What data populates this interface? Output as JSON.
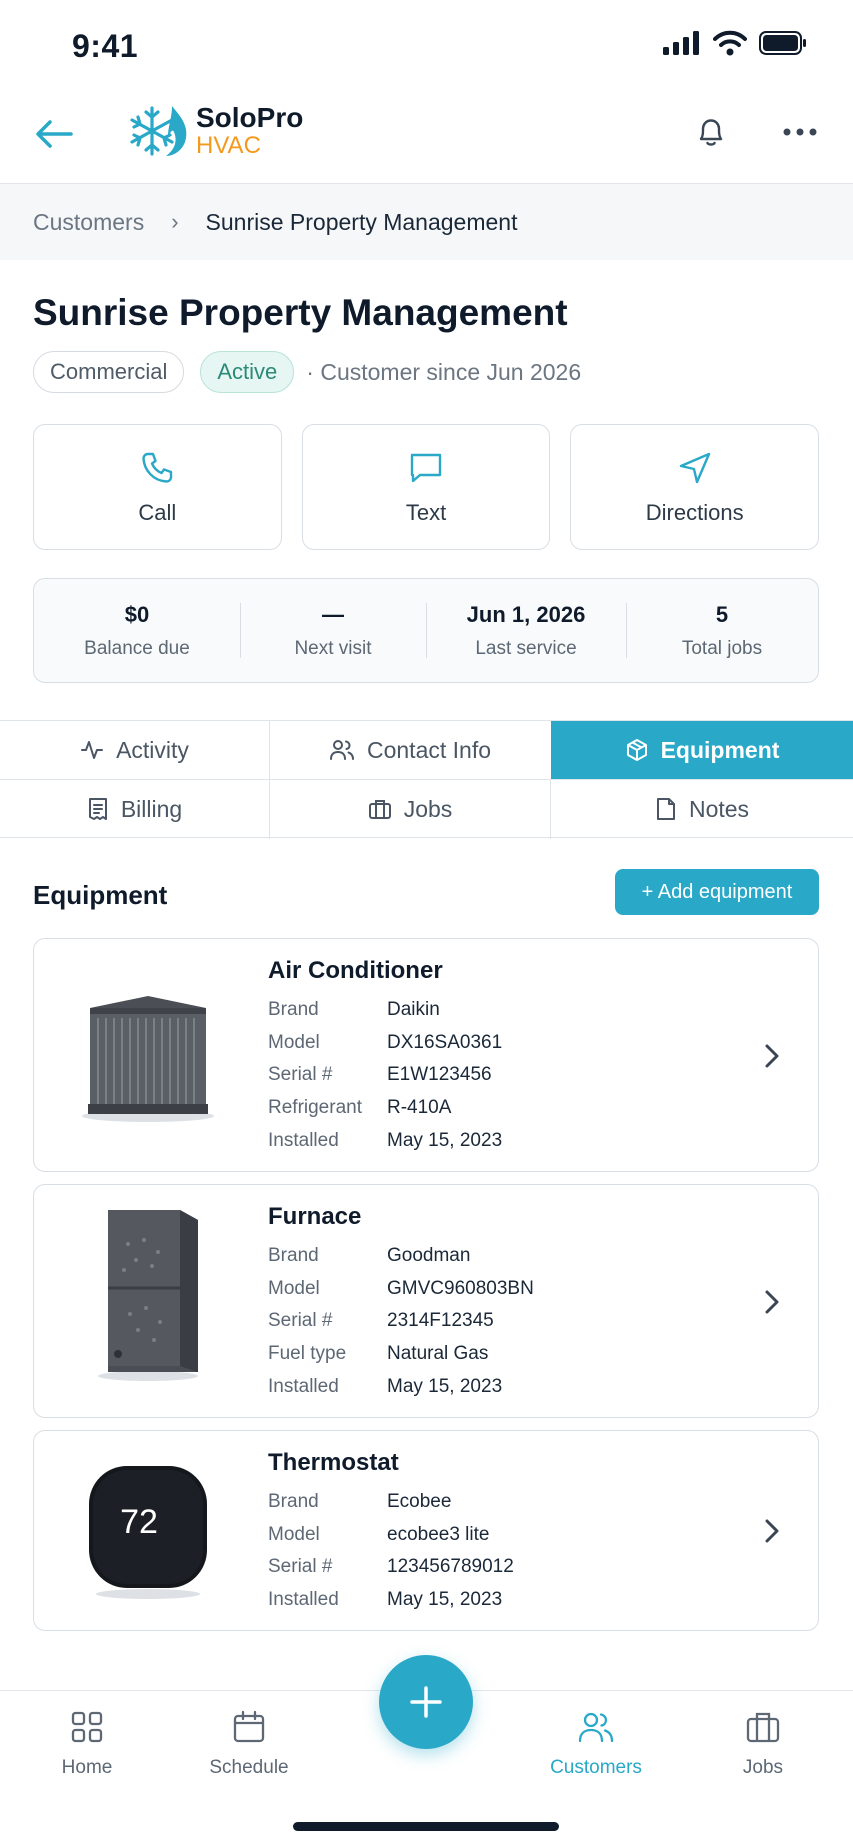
{
  "status_bar": {
    "time": "9:41"
  },
  "header": {
    "logo_name": "SoloPro",
    "logo_sub": "HVAC"
  },
  "breadcrumb": {
    "parent": "Customers",
    "separator": "›",
    "current": "Sunrise Property Management"
  },
  "customer": {
    "name": "Sunrise Property Management",
    "type_badge": "Commercial",
    "status_badge": "Active",
    "since": "· Customer since Jun 2026"
  },
  "actions": [
    {
      "label": "Call",
      "icon": "phone-icon"
    },
    {
      "label": "Text",
      "icon": "message-icon"
    },
    {
      "label": "Directions",
      "icon": "navigation-icon"
    }
  ],
  "stats": [
    {
      "value": "$0",
      "label": "Balance due"
    },
    {
      "value": "—",
      "label": "Next visit"
    },
    {
      "value": "Jun 1, 2026",
      "label": "Last service"
    },
    {
      "value": "5",
      "label": "Total jobs"
    }
  ],
  "tabs": [
    {
      "label": "Activity",
      "icon": "activity-icon",
      "active": false
    },
    {
      "label": "Contact Info",
      "icon": "users-icon",
      "active": false
    },
    {
      "label": "Equipment",
      "icon": "box-icon",
      "active": true
    },
    {
      "label": "Billing",
      "icon": "receipt-icon",
      "active": false
    },
    {
      "label": "Jobs",
      "icon": "briefcase-icon",
      "active": false
    },
    {
      "label": "Notes",
      "icon": "note-icon",
      "active": false
    }
  ],
  "equipment_section": {
    "title": "Equipment",
    "add_label": "+ Add equipment"
  },
  "equipment": [
    {
      "name": "Air Conditioner",
      "specs": [
        {
          "label": "Brand",
          "value": "Daikin"
        },
        {
          "label": "Model",
          "value": "DX16SA0361"
        },
        {
          "label": "Serial #",
          "value": "E1W123456"
        },
        {
          "label": "Refrigerant",
          "value": "R-410A"
        },
        {
          "label": "Installed",
          "value": "May 15, 2023"
        }
      ]
    },
    {
      "name": "Furnace",
      "specs": [
        {
          "label": "Brand",
          "value": "Goodman"
        },
        {
          "label": "Model",
          "value": "GMVC960803BN"
        },
        {
          "label": "Serial #",
          "value": "2314F12345"
        },
        {
          "label": "Fuel type",
          "value": "Natural Gas"
        },
        {
          "label": "Installed",
          "value": "May 15, 2023"
        }
      ]
    },
    {
      "name": "Thermostat",
      "thermostat_reading": "72",
      "specs": [
        {
          "label": "Brand",
          "value": "Ecobee"
        },
        {
          "label": "Model",
          "value": "ecobee3 lite"
        },
        {
          "label": "Serial #",
          "value": "123456789012"
        },
        {
          "label": "Installed",
          "value": "May 15, 2023"
        }
      ]
    }
  ],
  "bottom_nav": [
    {
      "label": "Home",
      "icon": "grid-icon",
      "active": false
    },
    {
      "label": "Schedule",
      "icon": "calendar-icon",
      "active": false
    },
    {
      "label": "Customers",
      "icon": "users-icon",
      "active": true
    },
    {
      "label": "Jobs",
      "icon": "briefcase-icon",
      "active": false
    }
  ],
  "colors": {
    "accent": "#29a8c8",
    "brand_orange": "#f39a1e",
    "active_badge": "#2c8a78"
  }
}
